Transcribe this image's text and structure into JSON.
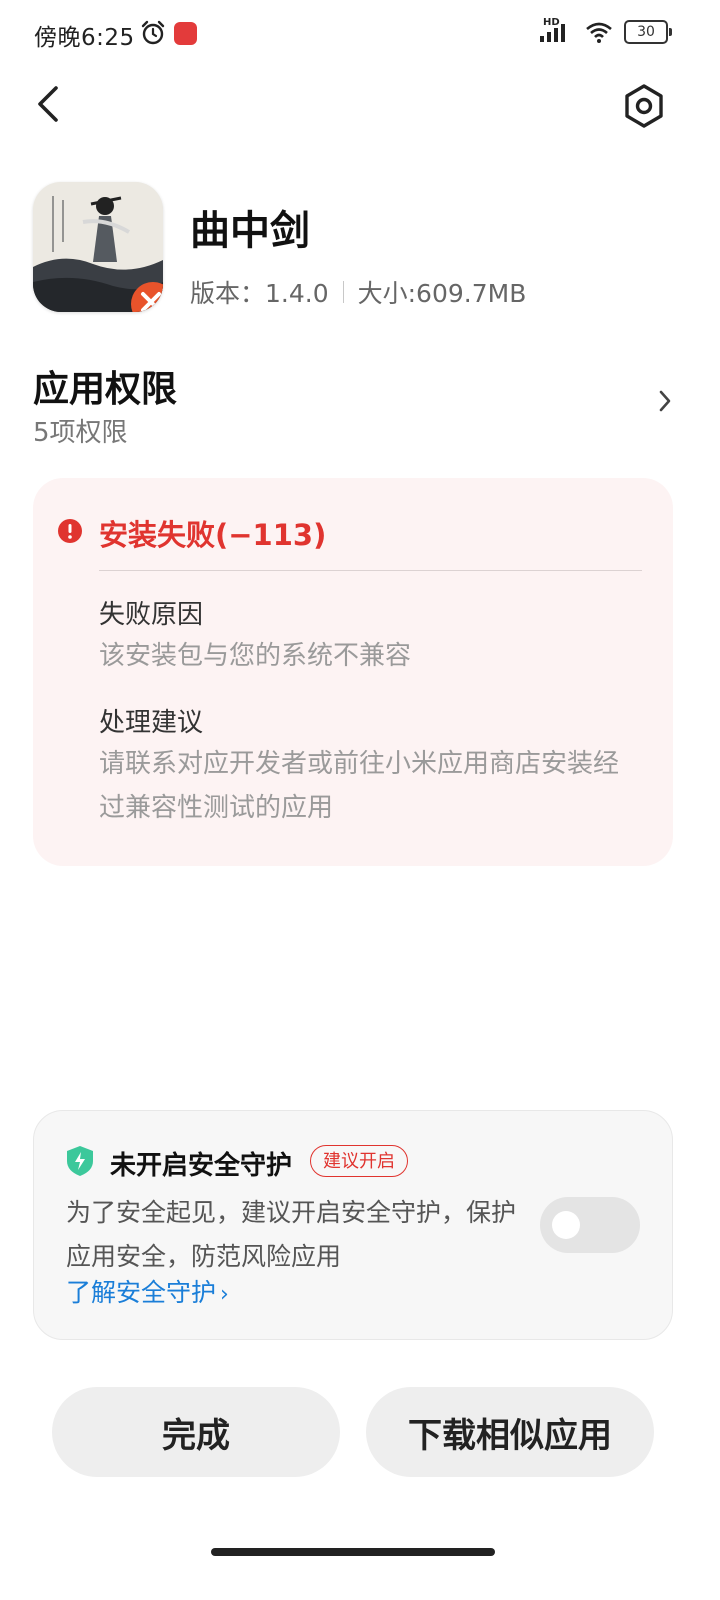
{
  "status_bar": {
    "time": "傍晚6:25",
    "network": "HD",
    "battery": "30"
  },
  "header": {
    "back_icon": "back-arrow-icon",
    "settings_icon": "settings-icon"
  },
  "app": {
    "name": "曲中剑",
    "version": "版本：1.4.0",
    "size": "大小:609.7MB"
  },
  "permissions": {
    "title": "应用权限",
    "subtitle": "5项权限"
  },
  "error": {
    "title": "安装失败(−113)",
    "reason_label": "失败原因",
    "reason_text": "该安装包与您的系统不兼容",
    "advice_label": "处理建议",
    "advice_text": "请联系对应开发者或前往小米应用商店安装经过兼容性测试的应用",
    "color": "#e0342f"
  },
  "security": {
    "title": "未开启安全守护",
    "badge": "建议开启",
    "description": "为了安全起见，建议开启安全守护，保护应用安全，防范风险应用",
    "link": "了解安全守护",
    "toggle_on": false,
    "link_color": "#1a7ed8",
    "shield_color": "#3cc89b"
  },
  "buttons": {
    "done": "完成",
    "download_similar": "下载相似应用"
  }
}
